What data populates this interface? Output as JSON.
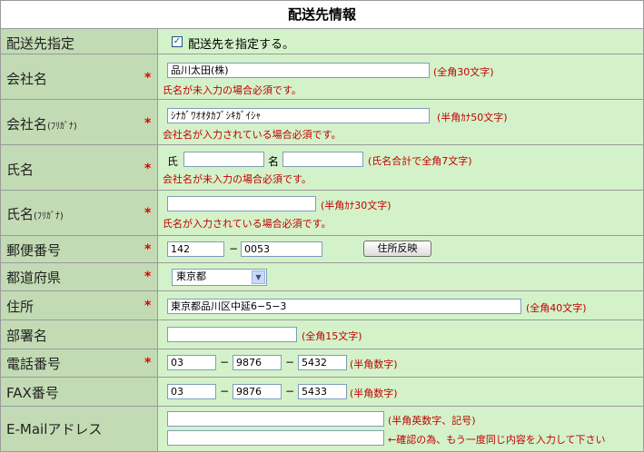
{
  "title": "配送先情報",
  "required_mark": "*",
  "rows": {
    "ship_to": {
      "label": "配送先指定",
      "checkbox_checked": true,
      "checkbox_label": "配送先を指定する。"
    },
    "company": {
      "label": "会社名",
      "value": "品川太田(株)",
      "note": "(全角30文字)",
      "help": "氏名が未入力の場合必須です。"
    },
    "company_kana": {
      "label": "会社名",
      "label_small": "(ﾌﾘｶﾞﾅ)",
      "value": "ｼﾅｶﾞﾜｵｵﾀｶﾌﾞｼｷｶﾞｲｼｬ",
      "note": "(半角ｶﾅ50文字)",
      "help": "会社名が入力されている場合必須です。"
    },
    "name": {
      "label": "氏名",
      "sei_label": "氏",
      "sei_value": "",
      "mei_label": "名",
      "mei_value": "",
      "note": "(氏名合計で全角7文字)",
      "help": "会社名が未入力の場合必須です。"
    },
    "name_kana": {
      "label": "氏名",
      "label_small": "(ﾌﾘｶﾞﾅ)",
      "value": "",
      "note": "(半角ｶﾅ30文字)",
      "help": "氏名が入力されている場合必須です。"
    },
    "postal": {
      "label": "郵便番号",
      "part1": "142",
      "sep": "−",
      "part2": "0053",
      "button": "住所反映"
    },
    "prefecture": {
      "label": "都道府県",
      "selected": "東京都"
    },
    "address": {
      "label": "住所",
      "value": "東京都品川区中延6−5−3",
      "note": "(全角40文字)"
    },
    "department": {
      "label": "部署名",
      "value": "",
      "note": "(全角15文字)"
    },
    "phone": {
      "label": "電話番号",
      "p1": "03",
      "p2": "9876",
      "p3": "5432",
      "sep": "−",
      "note": "(半角数字)"
    },
    "fax": {
      "label": "FAX番号",
      "p1": "03",
      "p2": "9876",
      "p3": "5433",
      "sep": "−",
      "note": "(半角数字)"
    },
    "email": {
      "label": "E-Mailアドレス",
      "value": "",
      "confirm_value": "",
      "note": "(半角英数字、記号)",
      "confirm_note": "←確認の為、もう一度同じ内容を入力して下さい"
    }
  },
  "colors": {
    "label_bg": "#c2dbb4",
    "value_bg": "#d4f2c9",
    "required": "#e00000",
    "note": "#c00000"
  }
}
